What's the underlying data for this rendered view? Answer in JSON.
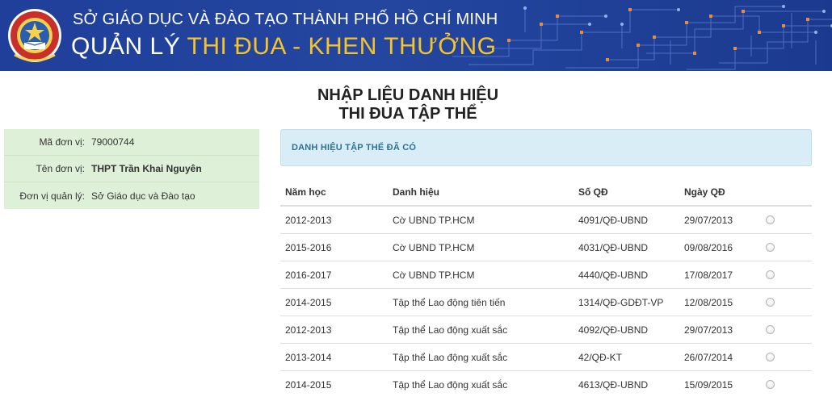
{
  "header": {
    "line1": "SỞ GIÁO DỤC VÀ ĐÀO TẠO THÀNH PHỐ HỒ CHÍ MINH",
    "line2_white": "QUẢN LÝ ",
    "line2_yellow": "THI ĐUA - KHEN THƯỞNG",
    "accent_color": "#f6c32a",
    "background_color": "#21439c"
  },
  "page": {
    "title_line1": "NHẬP LIỆU DANH HIỆU",
    "title_line2": "THI ĐUA TẬP THỂ"
  },
  "unit_info": [
    {
      "label": "Mã đơn vị:",
      "value": "79000744"
    },
    {
      "label": "Tên đơn vị:",
      "value": "THPT Trần Khai Nguyên"
    },
    {
      "label": "Đơn vị quản lý:",
      "value": "Sở Giáo dục và Đào tạo"
    }
  ],
  "panel": {
    "heading": "DANH HIỆU TẬP THỂ ĐÃ CÓ"
  },
  "table": {
    "columns": [
      "Năm học",
      "Danh hiệu",
      "Số QĐ",
      "Ngày QĐ"
    ],
    "rows": [
      [
        "2012-2013",
        "Cờ UBND TP.HCM",
        "4091/QĐ-UBND",
        "29/07/2013"
      ],
      [
        "2015-2016",
        "Cờ UBND TP.HCM",
        "4031/QĐ-UBND",
        "09/08/2016"
      ],
      [
        "2016-2017",
        "Cờ UBND TP.HCM",
        "4440/QĐ-UBND",
        "17/08/2017"
      ],
      [
        "2014-2015",
        "Tập thể Lao động tiên tiến",
        "1314/QĐ-GDĐT-VP",
        "12/08/2015"
      ],
      [
        "2012-2013",
        "Tập thể Lao động xuất sắc",
        "4092/QĐ-UBND",
        "29/07/2013"
      ],
      [
        "2013-2014",
        "Tập thể Lao động xuất sắc",
        "42/QĐ-KT",
        "26/07/2014"
      ],
      [
        "2014-2015",
        "Tập thể Lao động xuất sắc",
        "4613/QĐ-UBND",
        "15/09/2015"
      ]
    ]
  }
}
